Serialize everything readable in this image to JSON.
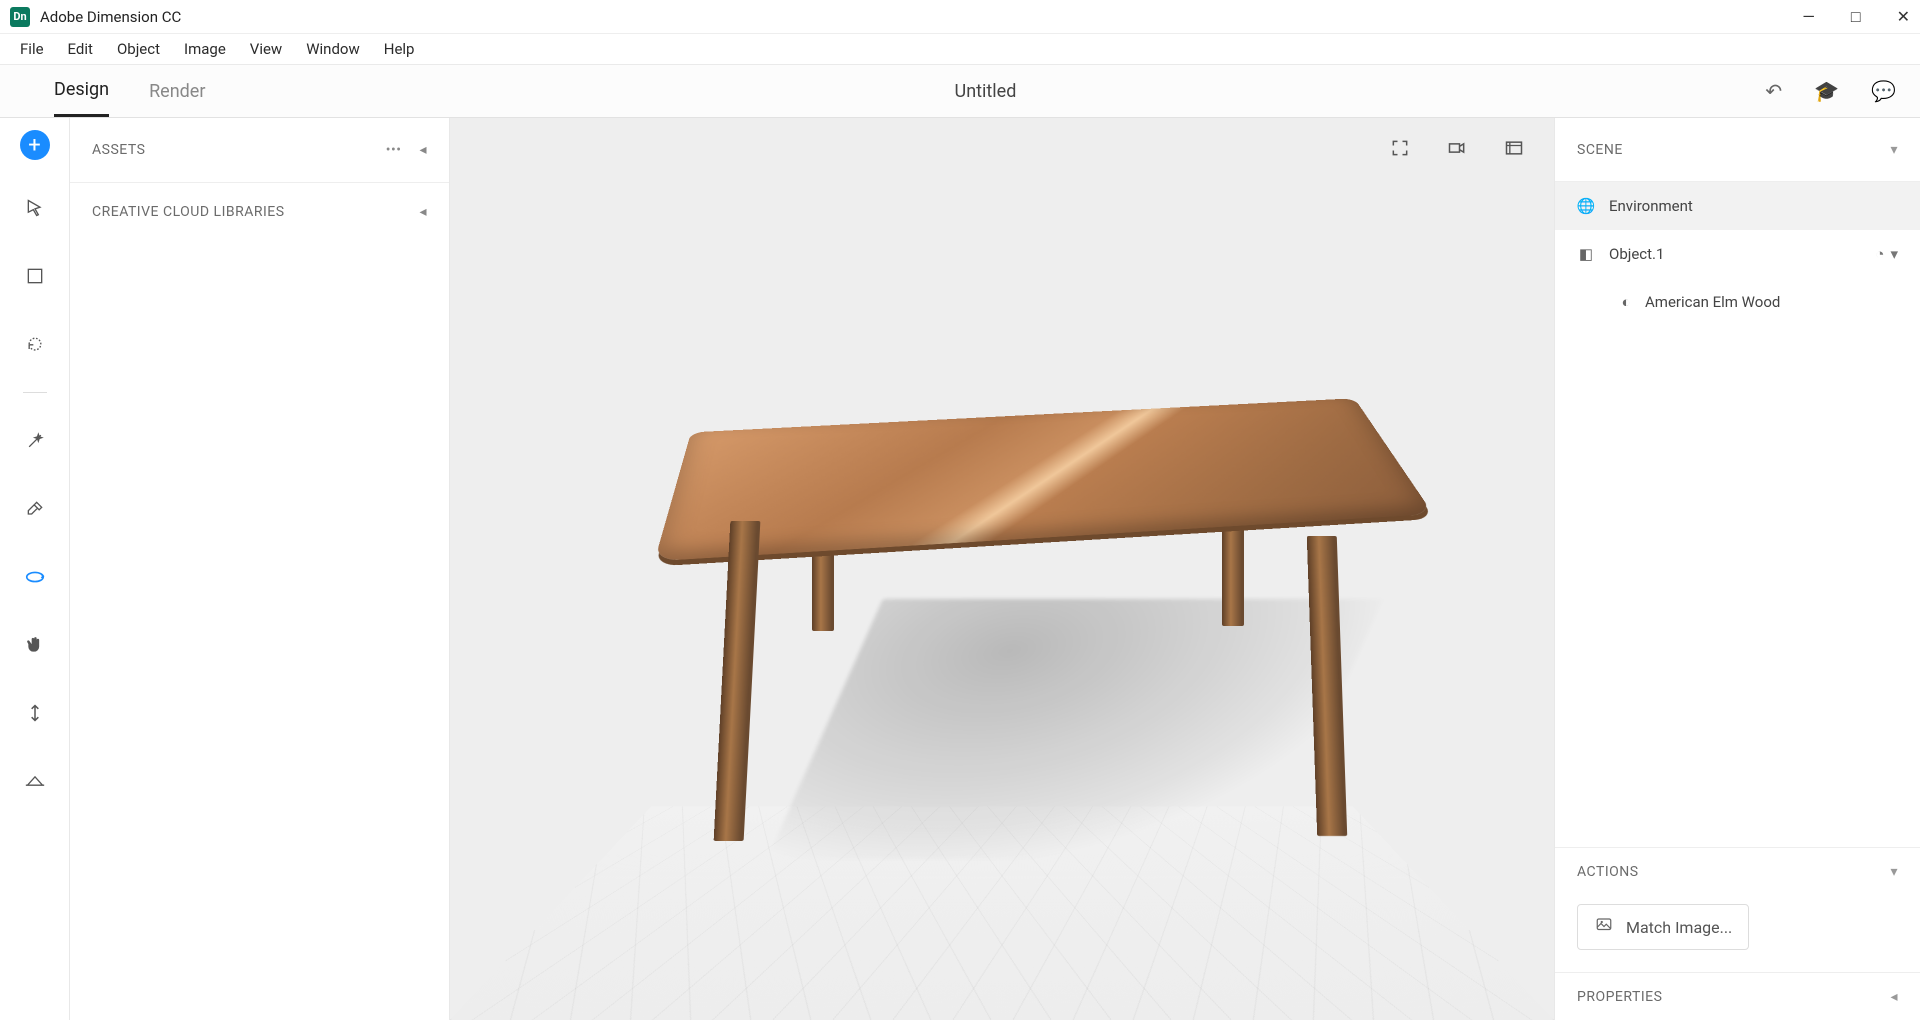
{
  "app": {
    "title": "Adobe Dimension CC",
    "icon_label": "Dn"
  },
  "menu": [
    "File",
    "Edit",
    "Object",
    "Image",
    "View",
    "Window",
    "Help"
  ],
  "modes": {
    "design": "Design",
    "render": "Render",
    "active": "design"
  },
  "document": {
    "title": "Untitled"
  },
  "left_panel": {
    "assets_label": "ASSETS",
    "libraries_label": "CREATIVE CLOUD LIBRARIES"
  },
  "scene_panel": {
    "header": "SCENE",
    "rows": [
      {
        "label": "Environment",
        "icon": "globe",
        "selected": true
      },
      {
        "label": "Object.1",
        "icon": "cube"
      },
      {
        "label": "American Elm Wood",
        "icon": "material",
        "indent": 2
      }
    ]
  },
  "actions": {
    "header": "ACTIONS",
    "match_image": "Match Image..."
  },
  "properties": {
    "header": "PROPERTIES"
  }
}
